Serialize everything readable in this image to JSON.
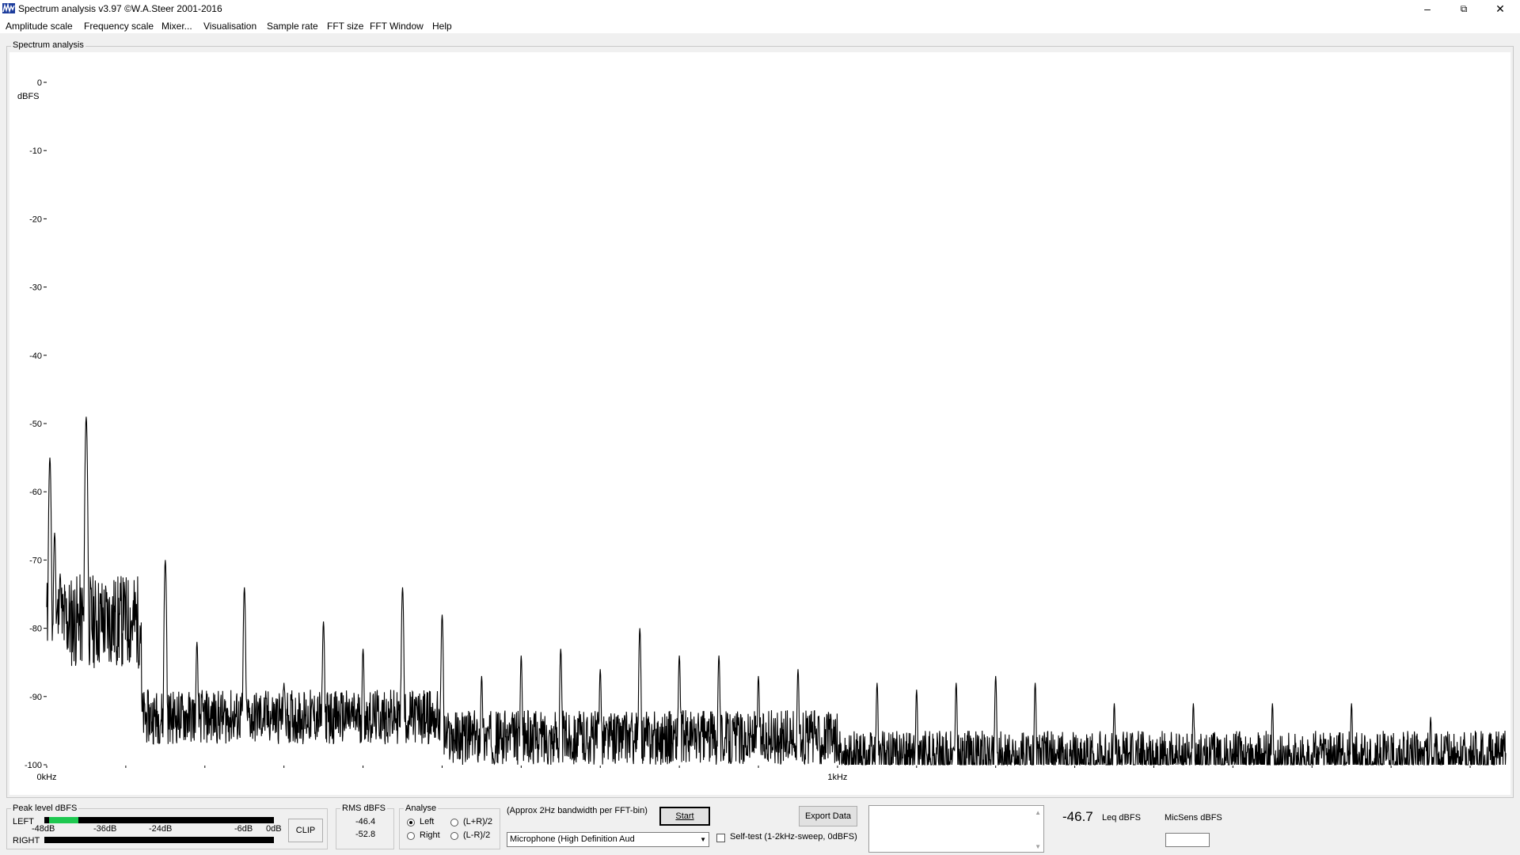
{
  "window": {
    "title": "Spectrum analysis v3.97  ©W.A.Steer 2001-2016",
    "minimize_icon": "–",
    "restore_icon": "⧉",
    "close_icon": "✕"
  },
  "menu": [
    "Amplitude scale",
    "Frequency scale",
    "Mixer...",
    "Visualisation",
    "Sample rate",
    "FFT size",
    "FFT Window",
    "Help"
  ],
  "spectrum_panel": {
    "label": "Spectrum analysis"
  },
  "chart_data": {
    "type": "line",
    "ylabel": "dBFS",
    "ylim": [
      -100,
      0
    ],
    "y_ticks": [
      "0",
      "-10",
      "-20",
      "-30",
      "-40",
      "-50",
      "-60",
      "-70",
      "-80",
      "-90",
      "-100"
    ],
    "x_tick_labels": [
      "0kHz",
      "1kHz"
    ],
    "x_range_hz": [
      0,
      1845
    ],
    "grid": false,
    "line_color": "#000000",
    "peaks": [
      {
        "x": 4,
        "y": -55
      },
      {
        "x": 10,
        "y": -66
      },
      {
        "x": 17,
        "y": -72
      },
      {
        "x": 24,
        "y": -80
      },
      {
        "x": 34,
        "y": -84
      },
      {
        "x": 40,
        "y": -81
      },
      {
        "x": 50,
        "y": -49
      },
      {
        "x": 66,
        "y": -86
      },
      {
        "x": 80,
        "y": -83
      },
      {
        "x": 98,
        "y": -77
      },
      {
        "x": 118,
        "y": -88
      },
      {
        "x": 150,
        "y": -70
      },
      {
        "x": 190,
        "y": -82
      },
      {
        "x": 250,
        "y": -74
      },
      {
        "x": 300,
        "y": -88
      },
      {
        "x": 350,
        "y": -79
      },
      {
        "x": 400,
        "y": -83
      },
      {
        "x": 450,
        "y": -74
      },
      {
        "x": 500,
        "y": -78
      },
      {
        "x": 550,
        "y": -87
      },
      {
        "x": 600,
        "y": -84
      },
      {
        "x": 650,
        "y": -83
      },
      {
        "x": 700,
        "y": -86
      },
      {
        "x": 750,
        "y": -80
      },
      {
        "x": 800,
        "y": -84
      },
      {
        "x": 850,
        "y": -84
      },
      {
        "x": 900,
        "y": -87
      },
      {
        "x": 950,
        "y": -86
      },
      {
        "x": 1050,
        "y": -88
      },
      {
        "x": 1100,
        "y": -89
      },
      {
        "x": 1150,
        "y": -88
      },
      {
        "x": 1200,
        "y": -87
      },
      {
        "x": 1250,
        "y": -88
      },
      {
        "x": 1350,
        "y": -91
      },
      {
        "x": 1450,
        "y": -91
      },
      {
        "x": 1550,
        "y": -91
      },
      {
        "x": 1650,
        "y": -91
      },
      {
        "x": 1750,
        "y": -93
      },
      {
        "x": 1840,
        "y": -98
      }
    ]
  },
  "peak_panel": {
    "label": "Peak level dBFS",
    "left": "LEFT",
    "right": "RIGHT",
    "scale": [
      "-48dB",
      "-36dB",
      "-24dB",
      "-6dB",
      "0dB"
    ],
    "clip": "CLIP",
    "left_fill_fraction": 0.13,
    "right_fill_fraction": 0.0,
    "meter_color": "#1ec850"
  },
  "rms_panel": {
    "label": "RMS dBFS",
    "left_value": "-46.4",
    "right_value": "-52.8"
  },
  "analyse_panel": {
    "label": "Analyse",
    "left": "Left",
    "right": "Right",
    "lpr": "(L+R)/2",
    "lmr": "(L-R)/2",
    "selected": "Left"
  },
  "bandwidth_text": "(Approx 2Hz bandwidth per FFT-bin)",
  "start_button": "Start",
  "device_select": "Microphone (High Definition Aud",
  "self_test": "Self-test  (1-2kHz-sweep, 0dBFS)",
  "export_button": "Export Data",
  "leq_value": "-46.7",
  "leq_label": "Leq dBFS",
  "micsens_label": "MicSens dBFS",
  "micsens_value": ""
}
